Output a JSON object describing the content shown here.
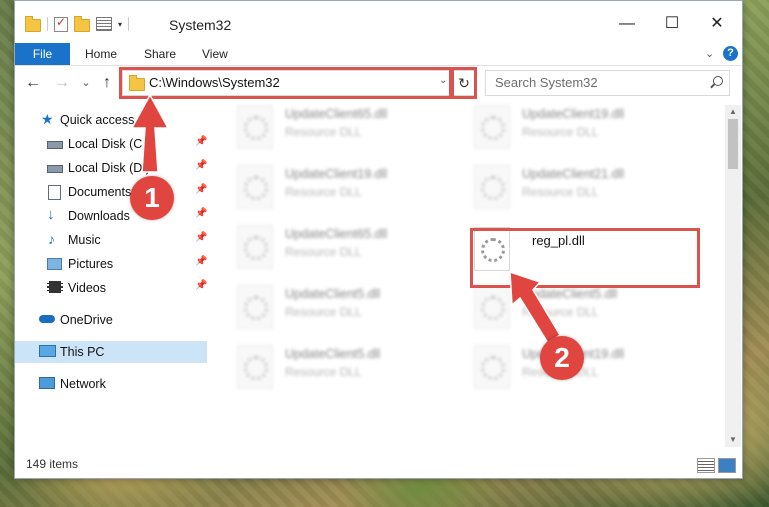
{
  "window": {
    "title": "System32",
    "minimize": "—",
    "maximize": "☐",
    "close": "✕"
  },
  "ribbon": {
    "tabs": [
      "File",
      "Home",
      "Share",
      "View"
    ],
    "expand_icon": "chevron-down-icon",
    "help": "?"
  },
  "nav": {
    "back": "←",
    "forward": "→",
    "recent": "⌄",
    "up": "↑"
  },
  "address": {
    "path": "C:\\Windows\\System32",
    "dropdown": "⌄",
    "refresh": "↻"
  },
  "search": {
    "placeholder": "Search System32"
  },
  "sidebar": {
    "items": [
      {
        "label": "Quick access",
        "icon": "star-icon"
      },
      {
        "label": "Local Disk (C:)",
        "icon": "drive-icon",
        "pinned": true
      },
      {
        "label": "Local Disk (D:)",
        "icon": "drive-icon",
        "pinned": true
      },
      {
        "label": "Documents",
        "icon": "documents-icon",
        "pinned": true
      },
      {
        "label": "Downloads",
        "icon": "download-icon",
        "pinned": true
      },
      {
        "label": "Music",
        "icon": "music-icon",
        "pinned": true
      },
      {
        "label": "Pictures",
        "icon": "pictures-icon",
        "pinned": true
      },
      {
        "label": "Videos",
        "icon": "videos-icon",
        "pinned": true
      },
      {
        "label": "OneDrive",
        "icon": "cloud-icon"
      },
      {
        "label": "This PC",
        "icon": "computer-icon",
        "selected": true
      },
      {
        "label": "Network",
        "icon": "network-icon"
      }
    ]
  },
  "files": [
    {
      "name": "UpdateClient65.dll",
      "type": "Resource DLL"
    },
    {
      "name": "UpdateClient19.dll",
      "type": "Resource DLL"
    },
    {
      "name": "UpdateClient19.dll",
      "type": "Resource DLL"
    },
    {
      "name": "UpdateClient21.dll",
      "type": "Resource DLL"
    },
    {
      "name": "UpdateClient65.dll",
      "type": "Resource DLL"
    },
    {
      "name": "reg_pl.dll",
      "type": ""
    },
    {
      "name": "UpdateClient5.dll",
      "type": "Resource DLL"
    },
    {
      "name": "UpdateClient5.dll",
      "type": "Resource DLL"
    },
    {
      "name": "UpdateClient5.dll",
      "type": "Resource DLL"
    },
    {
      "name": "UpdateClient19.dll",
      "type": "Resource DLL"
    }
  ],
  "status": {
    "item_count": "149 items"
  },
  "annotations": {
    "step1": "1",
    "step2": "2",
    "color": "#e0453f"
  }
}
